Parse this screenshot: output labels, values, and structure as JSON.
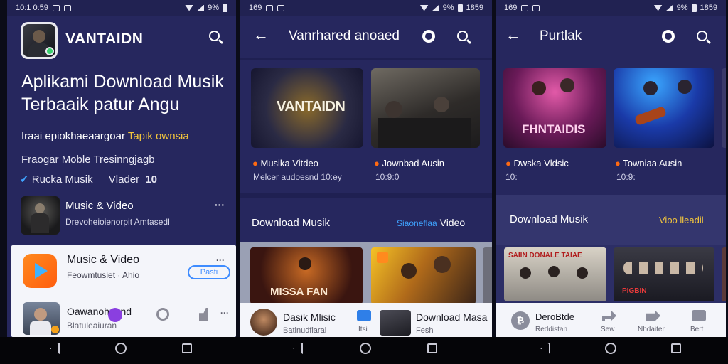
{
  "phone1": {
    "status_time": "10:1 0:59",
    "battery": "9%",
    "app_title": "VANTAIDN",
    "headline_line1": "Aplikami Download Musik",
    "headline_line2": "Terbaaik patur Angu",
    "sub_white": "Iraai epiokhaeaargoar",
    "sub_yellow": "Tapik ownsia",
    "line_mobile": "Fraogar Moble Tresinngjagb",
    "line_musik_label": "Rucka Musik",
    "line_musik_right": "Vlader",
    "line_musik_badge": "10",
    "row1_title": "Music & Video",
    "row1_subtitle": "Drevoheioienorpit Amtasedl",
    "row1_more": "···",
    "card_title": "Music & Video",
    "card_subtitle": "Feowmtusiet · Ahio",
    "card_more": "···",
    "card_button": "Pasti",
    "bottom_title": "Oawanohuand",
    "bottom_subtitle": "Blatuleaiuran",
    "bottom_more": "···"
  },
  "phone2": {
    "status_time": "169",
    "battery": "9%",
    "status_right": "1859",
    "header_title": "Vanrhared anoaed",
    "poster1_text": "VANTAIDN",
    "caption1_title": "Musika Vitdeo",
    "caption1_sub": "Melcer audoesnd 10:ey",
    "caption2_title": "Jownbad Ausin",
    "caption2_sub": "10:9:0",
    "section_title": "Download Musik",
    "section_link_blue": "Siaoneflaa",
    "section_link_white": "Video",
    "poster3_text": "MISSA FAN",
    "bottom_item1_title": "Dasik Mlisic",
    "bottom_item1_sub": "Batinudfiaral",
    "bottom_mid_label": "Itsi",
    "bottom_item2_title": "Download Masa",
    "bottom_item2_sub": "Fesh"
  },
  "phone3": {
    "status_time": "169",
    "battery": "9%",
    "status_right": "1859",
    "header_title": "Purtlak",
    "poster1_text": "FHNTAIDIS",
    "caption1_title": "Dwska Vldsic",
    "caption1_sub": "10:",
    "caption2_title": "Towniaa Ausin",
    "caption2_sub": "10:9:",
    "section_title": "Download Musik",
    "section_link": "Vioo lleadil",
    "poster3_text": "SAIIN DONALE TAIAE",
    "poster4_text": "PIGBIN",
    "bottom_title": "DeroBtde",
    "bottom_sub": "Reddistan",
    "tab1": "Sew",
    "tab2": "Nhdaiter",
    "tab3": "Bert"
  },
  "colors": {
    "panel_bg": "#26275e",
    "accent_yellow": "#f2c53d",
    "accent_blue": "#3fa3ff",
    "accent_orange": "#ff6a12",
    "sheet_white": "#f4f5fa"
  },
  "icons": [
    "search-icon",
    "back-arrow-icon",
    "shazam-icon",
    "more-icon",
    "play-icon",
    "nav-back-icon",
    "nav-home-icon",
    "nav-recents-icon"
  ]
}
